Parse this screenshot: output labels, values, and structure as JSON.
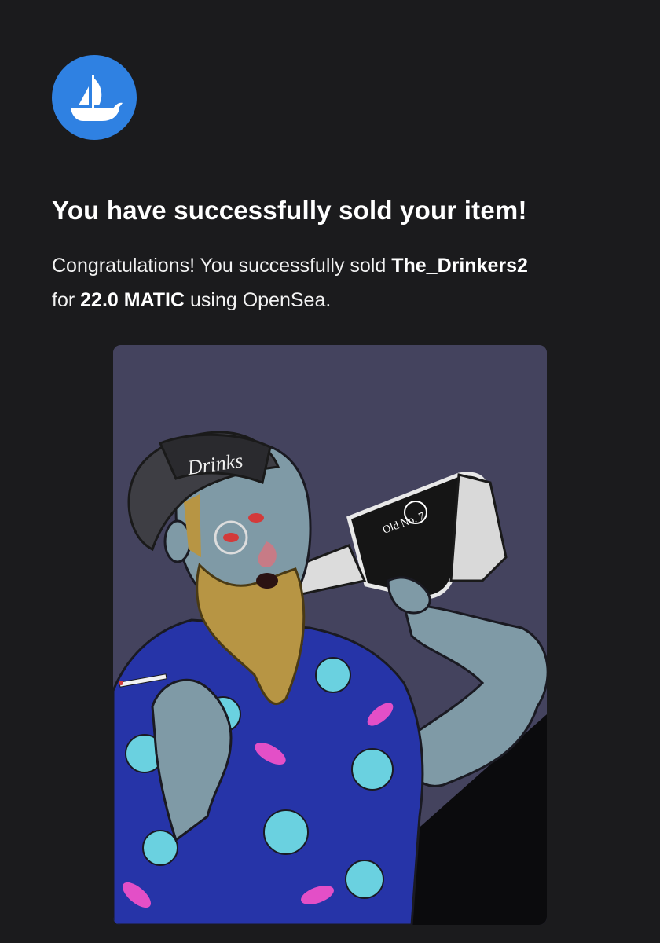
{
  "brand": {
    "logo_icon": "opensea-ship-icon",
    "color": "#2f81e2"
  },
  "email": {
    "headline": "You have successfully sold your item!",
    "message": {
      "intro": "Congratulations! You successfully sold",
      "item_name": "The_Drinkers2",
      "for_word": "for",
      "price": "22.0 MATIC",
      "outro": "using OpenSea."
    }
  },
  "nft_image": {
    "semantic": "nft-artwork-bearded-man-drinking",
    "background_color": "#44435e",
    "cap_text": "Drinks"
  }
}
